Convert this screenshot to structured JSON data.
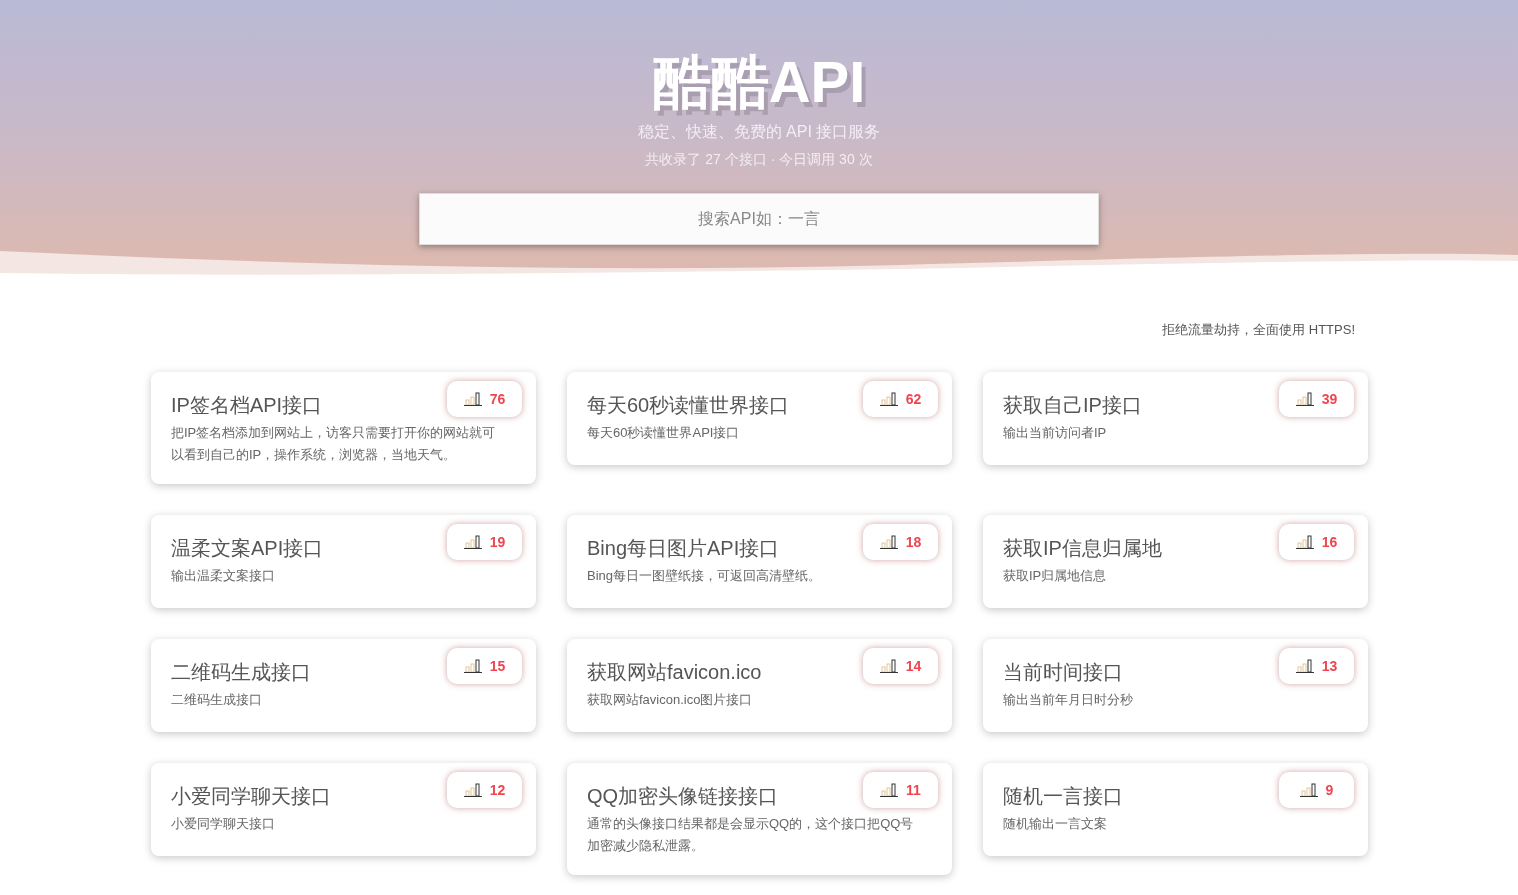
{
  "header": {
    "title": "酷酷API",
    "subtitle": "稳定、快速、免费的 API 接口服务",
    "stats": "共收录了 27 个接口 · 今日调用 30 次"
  },
  "search": {
    "placeholder": "搜索API如：一言"
  },
  "notice": "拒绝流量劫持，全面使用 HTTPS!",
  "apis": [
    {
      "title": "IP签名档API接口",
      "description": "把IP签名档添加到网站上，访客只需要打开你的网站就可以看到自己的IP，操作系统，浏览器，当地天气。",
      "count": "76"
    },
    {
      "title": "每天60秒读懂世界接口",
      "description": "每天60秒读懂世界API接口",
      "count": "62"
    },
    {
      "title": "获取自己IP接口",
      "description": "输出当前访问者IP",
      "count": "39"
    },
    {
      "title": "温柔文案API接口",
      "description": "输出温柔文案接口",
      "count": "19"
    },
    {
      "title": "Bing每日图片API接口",
      "description": "Bing每日一图壁纸接，可返回高清壁纸。",
      "count": "18"
    },
    {
      "title": "获取IP信息归属地",
      "description": "获取IP归属地信息",
      "count": "16"
    },
    {
      "title": "二维码生成接口",
      "description": "二维码生成接口",
      "count": "15"
    },
    {
      "title": "获取网站favicon.ico",
      "description": "获取网站favicon.ico图片接口",
      "count": "14"
    },
    {
      "title": "当前时间接口",
      "description": "输出当前年月日时分秒",
      "count": "13"
    },
    {
      "title": "小爱同学聊天接口",
      "description": "小爱同学聊天接口",
      "count": "12"
    },
    {
      "title": "QQ加密头像链接接口",
      "description": "通常的头像接口结果都是会显示QQ的，这个接口把QQ号加密减少隐私泄露。",
      "count": "11"
    },
    {
      "title": "随机一言接口",
      "description": "随机输出一言文案",
      "count": "9"
    }
  ]
}
